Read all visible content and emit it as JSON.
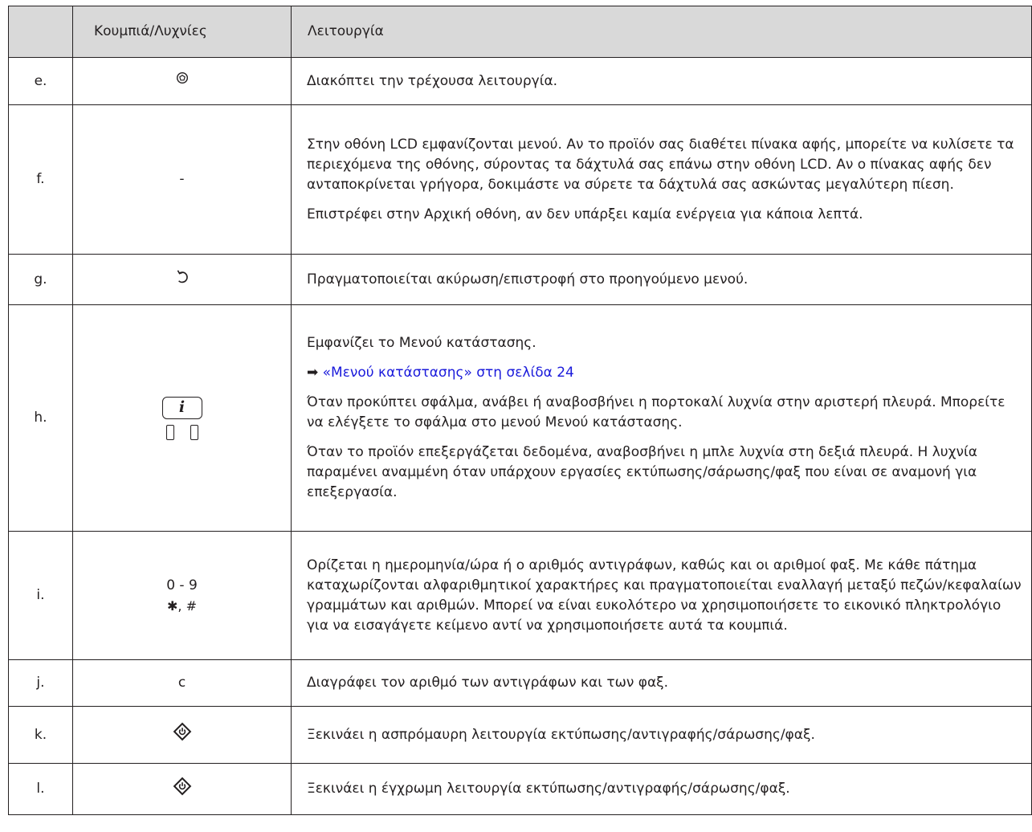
{
  "header": {
    "col_letter": "",
    "col_button": "Κουμπιά/Λυχνίες",
    "col_function": "Λειτουργία"
  },
  "rows": [
    {
      "letter": "e.",
      "icon": "stop-icon",
      "paragraphs": [
        "Διακόπτει την τρέχουσα λειτουργία."
      ]
    },
    {
      "letter": "f.",
      "control_text": "-",
      "paragraphs": [
        "Στην οθόνη LCD εμφανίζονται μενού. Αν το προϊόν σας διαθέτει πίνακα αφής, μπορείτε να κυλίσετε τα περιεχόμενα της οθόνης, σύροντας τα δάχτυλά σας επάνω στην οθόνη LCD. Αν ο πίνακας αφής δεν ανταποκρίνεται γρήγορα, δοκιμάστε να σύρετε τα δάχτυλά σας ασκώντας μεγαλύτερη πίεση.",
        "Επιστρέφει στην Αρχική οθόνη, αν δεν υπάρξει καμία ενέργεια για κάποια λεπτά."
      ]
    },
    {
      "letter": "g.",
      "icon": "back-icon",
      "paragraphs": [
        "Πραγματοποιείται ακύρωση/επιστροφή στο προηγούμενο μενού."
      ]
    },
    {
      "letter": "h.",
      "icon": "info-button-icon",
      "info_glyph": "i",
      "paragraphs": [
        "Εμφανίζει το Μενού κατάστασης.",
        "Όταν προκύπτει σφάλμα, ανάβει ή αναβοσβήνει η πορτοκαλί λυχνία στην αριστερή πλευρά. Μπορείτε να ελέγξετε το σφάλμα στο μενού Μενού κατάστασης.",
        "Όταν το προϊόν επεξεργάζεται δεδομένα, αναβοσβήνει η μπλε λυχνία στη δεξιά πλευρά. Η λυχνία παραμένει αναμμένη όταν υπάρχουν εργασίες εκτύπωσης/σάρωσης/φαξ που είναι σε αναμονή για επεξεργασία."
      ],
      "link_arrow": "➡",
      "link_text": "«Μενού κατάστασης» στη σελίδα 24"
    },
    {
      "letter": "i.",
      "control_line1": "0 - 9",
      "control_line2": "✱, #",
      "paragraphs": [
        "Ορίζεται η ημερομηνία/ώρα ή ο αριθμός αντιγράφων, καθώς και οι αριθμοί φαξ. Με κάθε πάτημα καταχωρίζονται αλφαριθμητικοί χαρακτήρες και πραγματοποιείται εναλλαγή μεταξύ πεζών/κεφαλαίων γραμμάτων και αριθμών. Μπορεί να είναι ευκολότερο να χρησιμοποιήσετε το εικονικό πληκτρολόγιο για να εισαγάγετε κείμενο αντί να χρησιμοποιήσετε αυτά τα κουμπιά."
      ]
    },
    {
      "letter": "j.",
      "control_text": "c",
      "paragraphs": [
        "Διαγράφει τον αριθμό των αντιγράφων και των φαξ."
      ]
    },
    {
      "letter": "k.",
      "icon": "start-bw-icon",
      "paragraphs": [
        "Ξεκινάει η ασπρόμαυρη λειτουργία εκτύπωσης/αντιγραφής/σάρωσης/φαξ."
      ]
    },
    {
      "letter": "l.",
      "icon": "start-color-icon",
      "paragraphs": [
        "Ξεκινάει η έγχρωμη λειτουργία εκτύπωσης/αντιγραφής/σάρωσης/φαξ."
      ]
    }
  ],
  "colors": {
    "header_bg": "#d9d9d9",
    "border": "#231f20",
    "link": "#1a1adb"
  }
}
